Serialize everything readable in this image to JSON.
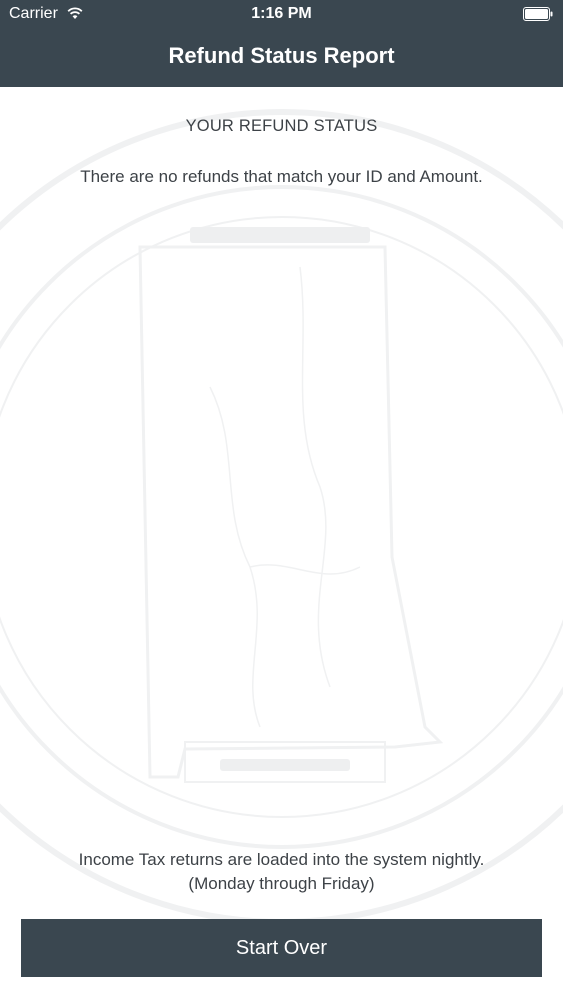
{
  "status_bar": {
    "carrier": "Carrier",
    "time": "1:16 PM",
    "wifi_icon": "wifi-icon",
    "battery_icon": "battery-icon"
  },
  "nav": {
    "title": "Refund Status Report"
  },
  "content": {
    "heading": "YOUR REFUND STATUS",
    "message": "There are no refunds that match your ID and Amount.",
    "note_line1": "Income Tax returns are loaded into the system nightly.",
    "note_line2": "(Monday through Friday)"
  },
  "actions": {
    "start_over_label": "Start Over"
  },
  "colors": {
    "bar_background": "#3a4750",
    "text": "#3d4247",
    "page_background": "#ffffff"
  }
}
